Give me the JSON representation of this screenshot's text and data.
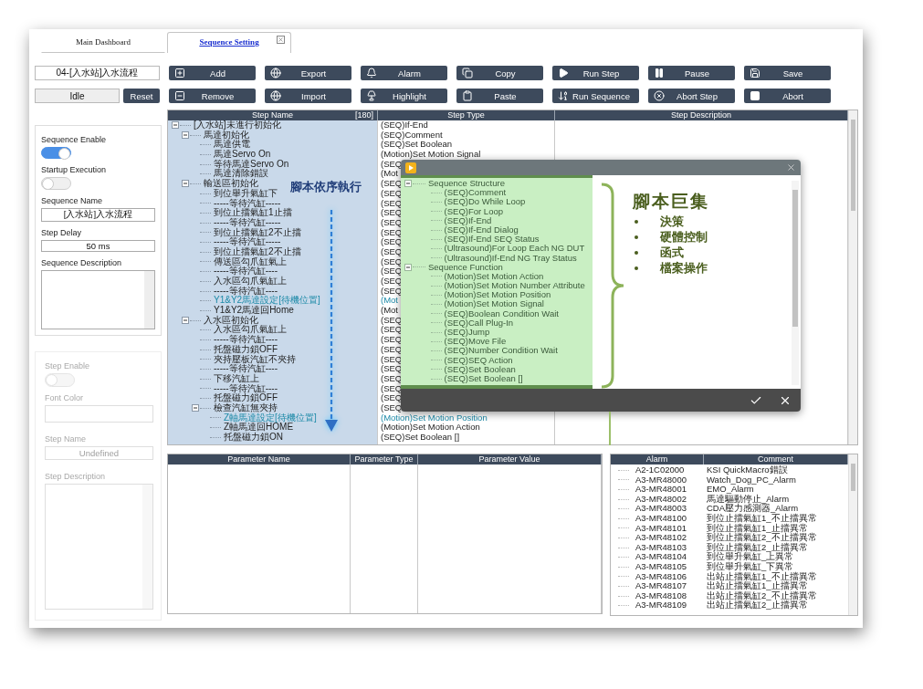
{
  "tabs": [
    {
      "label": "Main Dashboard",
      "selected": false,
      "closable": false
    },
    {
      "label": "Sequence Setting",
      "selected": true,
      "closable": true
    }
  ],
  "sequence_selector": {
    "value": "04-[入水站]入水流程"
  },
  "status": {
    "value": "Idle"
  },
  "reset_button": "Reset",
  "toolbar": [
    {
      "label": "Add",
      "kind": "add"
    },
    {
      "label": "Export",
      "kind": "export"
    },
    {
      "label": "Alarm",
      "kind": "alarm"
    },
    {
      "label": "Copy",
      "kind": "copy"
    },
    {
      "label": "Run Step",
      "kind": "runstep"
    },
    {
      "label": "Pause",
      "kind": "pause"
    },
    {
      "label": "Save",
      "kind": "save"
    },
    {
      "label": "Remove",
      "kind": "remove"
    },
    {
      "label": "Import",
      "kind": "import"
    },
    {
      "label": "Highlight",
      "kind": "highlight"
    },
    {
      "label": "Paste",
      "kind": "paste"
    },
    {
      "label": "Run Sequence",
      "kind": "runsequence"
    },
    {
      "label": "Abort Step",
      "kind": "abortstep"
    },
    {
      "label": "Abort",
      "kind": "abort"
    }
  ],
  "sequence_panel": {
    "enable": {
      "label": "Sequence Enable",
      "on": true
    },
    "startup": {
      "label": "Startup Execution",
      "on": false
    },
    "name": {
      "label": "Sequence Name",
      "value": "[入水站]入水流程"
    },
    "delay": {
      "label": "Step Delay",
      "value": "50 ms"
    },
    "description": {
      "label": "Sequence Description"
    }
  },
  "step_panel": {
    "disabled": true,
    "enable": {
      "label": "Step Enable",
      "on": false
    },
    "font_color": {
      "label": "Font Color"
    },
    "name": {
      "label": "Step Name",
      "value": "Undefined"
    },
    "description": {
      "label": "Step Description"
    }
  },
  "step_table": {
    "columns": [
      "Step Name",
      "Step Type",
      "Step Description"
    ],
    "count": "[180]",
    "steps": [
      {
        "name": "[入水站]未進行初始化",
        "type": "(SEQ)If-End",
        "highlighted": false,
        "expanded": true,
        "children": [
          {
            "name": "馬達初始化",
            "type": "(SEQ)Comment",
            "highlighted": false,
            "expanded": true,
            "children": [
              {
                "name": "馬達供電",
                "type": "(SEQ)Set Boolean",
                "highlighted": false
              },
              {
                "name": "馬達Servo On",
                "type": "(Motion)Set Motion Signal",
                "highlighted": false
              },
              {
                "name": "等待馬達Servo On",
                "type": "(SEQ",
                "highlighted": false
              },
              {
                "name": "馬達清除錯誤",
                "type": "(Mot",
                "highlighted": false
              }
            ]
          },
          {
            "name": "輸送區初始化",
            "type": "(SEQ",
            "highlighted": false,
            "expanded": true,
            "children": [
              {
                "name": "到位舉升氣缸下",
                "type": "(SEQ",
                "highlighted": false
              },
              {
                "name": "-----等待汽缸-----",
                "type": "(SEQ",
                "highlighted": false
              },
              {
                "name": "到位止擋氣缸1止擋",
                "type": "(SEQ",
                "highlighted": false
              },
              {
                "name": "-----等待汽缸-----",
                "type": "(SEQ",
                "highlighted": false
              },
              {
                "name": "到位止擋氣缸2不止擋",
                "type": "(SEQ",
                "highlighted": false
              },
              {
                "name": "-----等待汽缸-----",
                "type": "(SEQ",
                "highlighted": false
              },
              {
                "name": "到位止擋氣缸2不止擋",
                "type": "(SEQ",
                "highlighted": false
              },
              {
                "name": "傳送區勾爪缸氣上",
                "type": "(SEQ",
                "highlighted": false
              },
              {
                "name": "-----等待汽缸----",
                "type": "(SEQ",
                "highlighted": false
              },
              {
                "name": "入水區勾爪氣缸上",
                "type": "(SEQ",
                "highlighted": false
              },
              {
                "name": "-----等待汽缸----",
                "type": "(SEQ",
                "highlighted": false
              },
              {
                "name": "Y1&Y2馬達設定[待機位置]",
                "type": "(Mot",
                "highlighted": true
              },
              {
                "name": "Y1&Y2馬達回Home",
                "type": "(Mot",
                "highlighted": false
              }
            ]
          },
          {
            "name": "入水區初始化",
            "type": "(SEQ",
            "highlighted": false,
            "expanded": true,
            "children": [
              {
                "name": "入水區勾爪氣缸上",
                "type": "(SEQ",
                "highlighted": false
              },
              {
                "name": "-----等待汽缸----",
                "type": "(SEQ",
                "highlighted": false
              },
              {
                "name": "托盤磁力鎖OFF",
                "type": "(SEQ",
                "highlighted": false
              },
              {
                "name": "夾持壓板汽缸不夾持",
                "type": "(SEQ",
                "highlighted": false
              },
              {
                "name": "-----等待汽缸----",
                "type": "(SEQ",
                "highlighted": false
              },
              {
                "name": "下移汽缸上",
                "type": "(SEQ",
                "highlighted": false
              },
              {
                "name": "-----等待汽缸----",
                "type": "(SEQ",
                "highlighted": false
              },
              {
                "name": "托盤磁力鎖OFF",
                "type": "(SEQ",
                "highlighted": false
              },
              {
                "name": "檢查汽缸無夾持",
                "type": "(SEQ",
                "highlighted": false,
                "expanded": true,
                "children": [
                  {
                    "name": "Z軸馬達設定[待機位置]",
                    "type": "(Motion)Set Motion Position",
                    "highlighted": true
                  },
                  {
                    "name": "Z軸馬達回HOME",
                    "type": "(Motion)Set Motion Action",
                    "highlighted": false
                  },
                  {
                    "name": "托盤磁力鎖ON",
                    "type": "(SEQ)Set Boolean []",
                    "highlighted": false
                  }
                ]
              }
            ]
          }
        ]
      }
    ]
  },
  "parameter_table": {
    "columns": [
      "Parameter Name",
      "Parameter Type",
      "Parameter Value"
    ]
  },
  "alarm_table": {
    "columns": [
      "Alarm",
      "Comment"
    ],
    "rows": [
      {
        "alarm": "A2-1C02000",
        "comment": "KSI QuickMacro錯誤"
      },
      {
        "alarm": "A3-MR48000",
        "comment": "Watch_Dog_PC_Alarm"
      },
      {
        "alarm": "A3-MR48001",
        "comment": "EMO_Alarm"
      },
      {
        "alarm": "A3-MR48002",
        "comment": "馬達驅動停止_Alarm"
      },
      {
        "alarm": "A3-MR48003",
        "comment": "CDA壓力感測器_Alarm"
      },
      {
        "alarm": "A3-MR48100",
        "comment": "到位止擋氣缸1_不止擋異常"
      },
      {
        "alarm": "A3-MR48101",
        "comment": "到位止擋氣缸1_止擋異常"
      },
      {
        "alarm": "A3-MR48102",
        "comment": "到位止擋氣缸2_不止擋異常"
      },
      {
        "alarm": "A3-MR48103",
        "comment": "到位止擋氣缸2_止擋異常"
      },
      {
        "alarm": "A3-MR48104",
        "comment": "到位舉升氣缸_上異常"
      },
      {
        "alarm": "A3-MR48105",
        "comment": "到位舉升氣缸_下異常"
      },
      {
        "alarm": "A3-MR48106",
        "comment": "出站止擋氣缸1_不止擋異常"
      },
      {
        "alarm": "A3-MR48107",
        "comment": "出站止擋氣缸1_止擋異常"
      },
      {
        "alarm": "A3-MR48108",
        "comment": "出站止擋氣缸2_不止擋異常"
      },
      {
        "alarm": "A3-MR48109",
        "comment": "出站止擋氣缸2_止擋異常"
      }
    ]
  },
  "annotation": {
    "text": "腳本依序執行"
  },
  "macro_dialog": {
    "tree": [
      {
        "label": "Sequence Structure",
        "expanded": true,
        "children": [
          {
            "label": "(SEQ)Comment"
          },
          {
            "label": "(SEQ)Do While Loop"
          },
          {
            "label": "(SEQ)For Loop"
          },
          {
            "label": "(SEQ)If-End"
          },
          {
            "label": "(SEQ)If-End Dialog"
          },
          {
            "label": "(SEQ)If-End SEQ Status"
          },
          {
            "label": "(Ultrasound)For Loop Each NG DUT"
          },
          {
            "label": "(Ultrasound)If-End NG Tray Status"
          }
        ]
      },
      {
        "label": "Sequence Function",
        "expanded": true,
        "children": [
          {
            "label": "(Motion)Set Motion Action"
          },
          {
            "label": "(Motion)Set Motion Number Attribute"
          },
          {
            "label": "(Motion)Set Motion Position"
          },
          {
            "label": "(Motion)Set Motion Signal"
          },
          {
            "label": "(SEQ)Boolean Condition Wait"
          },
          {
            "label": "(SEQ)Call Plug-In"
          },
          {
            "label": "(SEQ)Jump"
          },
          {
            "label": "(SEQ)Move File"
          },
          {
            "label": "(SEQ)Number Condition Wait"
          },
          {
            "label": "(SEQ)SEQ Action"
          },
          {
            "label": "(SEQ)Set Boolean"
          },
          {
            "label": "(SEQ)Set Boolean []"
          }
        ]
      }
    ],
    "note": {
      "title": "腳本巨集",
      "bullets": [
        "決策",
        "硬體控制",
        "函式",
        "檔案操作"
      ]
    }
  }
}
